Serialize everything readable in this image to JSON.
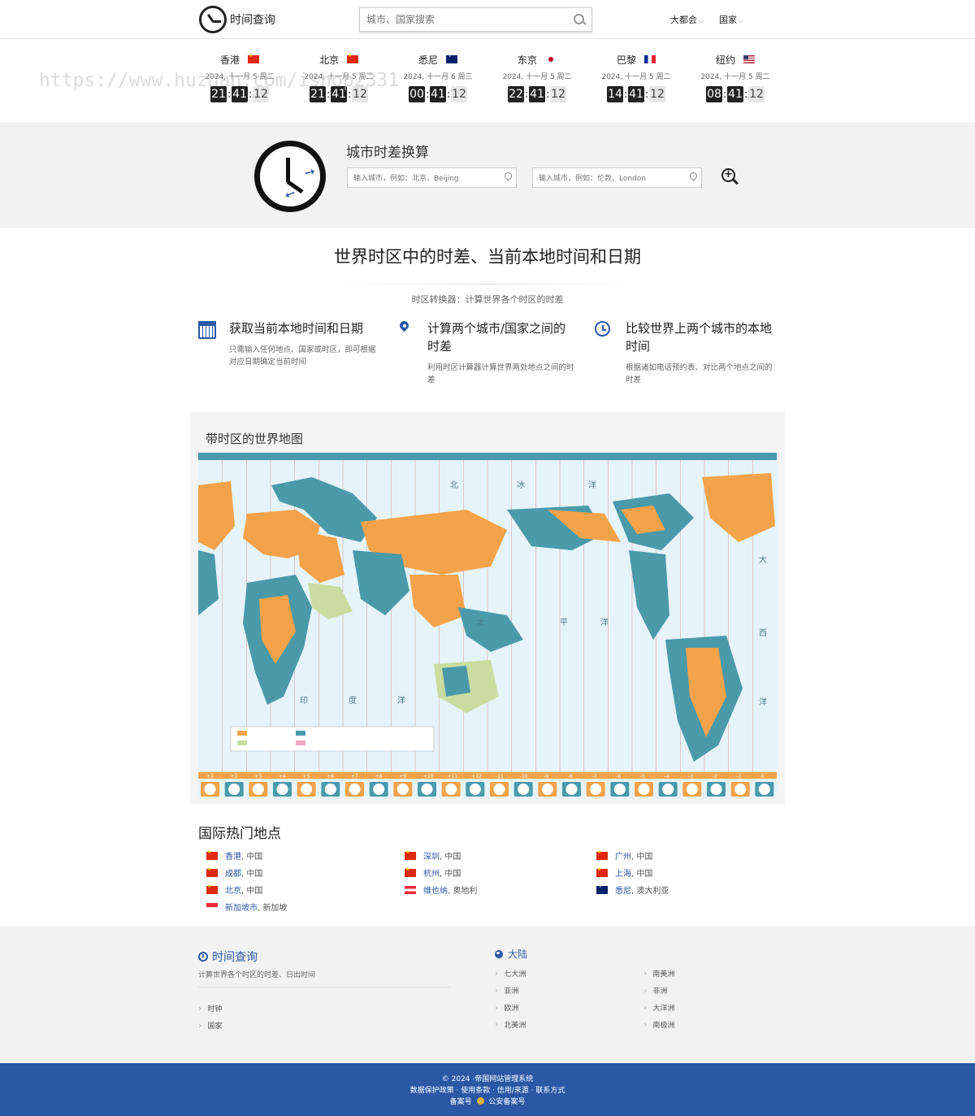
{
  "header": {
    "logo_text": "时间查询",
    "search_placeholder": "城市、国家搜索",
    "menu_metro": "大都会",
    "menu_country": "国家"
  },
  "watermark": "https://www.huzhan.com/ishop2331",
  "clocks": [
    {
      "city": "香港",
      "flag": "cn",
      "date": "2024, 十一月 5 周二",
      "hh": "21",
      "mm": "41",
      "ss": "12"
    },
    {
      "city": "北京",
      "flag": "cn",
      "date": "2024, 十一月 5 周二",
      "hh": "21",
      "mm": "41",
      "ss": "12"
    },
    {
      "city": "悉尼",
      "flag": "au",
      "date": "2024, 十一月 6 周三",
      "hh": "00",
      "mm": "41",
      "ss": "12"
    },
    {
      "city": "东京",
      "flag": "jp",
      "date": "2024, 十一月 5 周二",
      "hh": "22",
      "mm": "41",
      "ss": "12"
    },
    {
      "city": "巴黎",
      "flag": "fr",
      "date": "2024, 十一月 5 周二",
      "hh": "14",
      "mm": "41",
      "ss": "12"
    },
    {
      "city": "纽约",
      "flag": "us",
      "date": "2024, 十一月 5 周二",
      "hh": "08",
      "mm": "41",
      "ss": "12"
    }
  ],
  "converter": {
    "title": "城市时差换算",
    "from_placeholder": "输入城市，例如：北京、Beijing",
    "to_placeholder": "输入城市，例如：伦敦、London"
  },
  "intro": {
    "title": "世界时区中的时差、当前本地时间和日期",
    "subtitle": "时区转换器：计算世界各个时区的时差"
  },
  "features": [
    {
      "icon": "calendar-icon",
      "title": "获取当前本地时间和日期",
      "desc": "只需输入任何地点、国家或时区，即可根据对应日期确定当前时间"
    },
    {
      "icon": "map-pin-icon",
      "title": "计算两个城市/国家之间的时差",
      "desc": "利用时区计算器计算世界两处地点之间的时差"
    },
    {
      "icon": "clock-icon",
      "title": "比较世界上两个城市的本地时间",
      "desc": "根据诸如电话预约表、对比两个地点之间的时差"
    }
  ],
  "map": {
    "title": "带时区的世界地图",
    "ocean_labels": [
      "北",
      "冰",
      "洋",
      "太",
      "平",
      "洋",
      "印",
      "度",
      "洋",
      "大",
      "西",
      "洋"
    ],
    "offset_labels": [
      "+1",
      "+2",
      "+3",
      "+4",
      "+5",
      "+6",
      "+7",
      "+8",
      "+9",
      "+10",
      "+11",
      "+12",
      "-11",
      "-10",
      "-9",
      "-8",
      "-7",
      "-6",
      "-5",
      "-4",
      "-3",
      "-2",
      "-1",
      "0"
    ],
    "colors": {
      "ocean": "#e6f3fa",
      "land_orange": "#f5a34a",
      "land_teal": "#4a9aaa",
      "land_green": "#c9dda0",
      "line": "#c0392b"
    }
  },
  "popular": {
    "title": "国际热门地点",
    "places": [
      {
        "flag": "cn",
        "city": "香港",
        "country": ", 中国"
      },
      {
        "flag": "cn",
        "city": "深圳",
        "country": ", 中国"
      },
      {
        "flag": "cn",
        "city": "广州",
        "country": ", 中国"
      },
      {
        "flag": "cn",
        "city": "成都",
        "country": ", 中国"
      },
      {
        "flag": "cn",
        "city": "杭州",
        "country": ", 中国"
      },
      {
        "flag": "cn",
        "city": "上海",
        "country": ", 中国"
      },
      {
        "flag": "cn",
        "city": "北京",
        "country": ", 中国"
      },
      {
        "flag": "at",
        "city": "维也纳",
        "country": ", 奥地利"
      },
      {
        "flag": "au",
        "city": "悉尼",
        "country": ", 澳大利亚"
      },
      {
        "flag": "sg",
        "city": "新加坡市",
        "country": ", 新加坡"
      }
    ]
  },
  "footer": {
    "brand": "时间查询",
    "desc": "计算世界各个时区的时差、日出时间",
    "links": [
      "时钟",
      "国家"
    ],
    "continent_title": "大陆",
    "continents_left": [
      "七大洲",
      "亚洲",
      "欧洲",
      "北美洲"
    ],
    "continents_right": [
      "南美洲",
      "非洲",
      "大洋洲",
      "南极洲"
    ],
    "copyright": "© 2024 ·帝国网站管理系统",
    "policy": "数据保护政策 · 使用条款 · 信用/来源 · 联系方式",
    "record": "备案号",
    "police_record": "公安备案号"
  }
}
